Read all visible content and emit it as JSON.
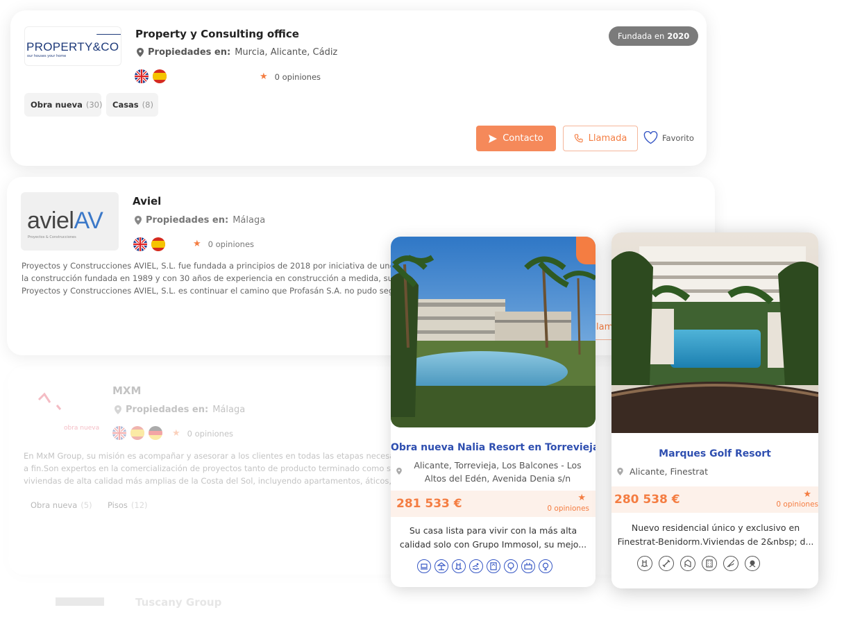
{
  "agencies": [
    {
      "name": "Property y Consulting office",
      "logo_text": "PROPERTY&CO",
      "logo_sub": "our houses your home",
      "locations_label": "Propiedades en:",
      "locations": "Murcia, Alicante, Cádiz",
      "reviews": "0 opiniones",
      "founded_label": "Fundada en",
      "founded_year": "2020",
      "tags": [
        {
          "label": "Obra nueva",
          "count": "(30)"
        },
        {
          "label": "Casas",
          "count": "(8)"
        }
      ],
      "contact_label": "Contacto",
      "call_label": "Llamada",
      "favorite_label": "Favorito"
    },
    {
      "name": "Aviel",
      "logo_text": "aviel",
      "logo_mark": "AV",
      "logo_sub": "Proyectos & Construcciones",
      "locations_label": "Propiedades en:",
      "locations": "Málaga",
      "reviews": "0 opiniones",
      "description": [
        "Proyectos y Construcciones AVIEL, S.L. fue fundada a principios de 2018 por iniciativa de uno de los",
        "la construcción fundada en 1989 y con 30 años de experiencia en construcción a medida, subcontr",
        "Proyectos y Construcciones AVIEL, S.L. es continuar el camino que Profasán S.A. no pudo seguir de"
      ],
      "call_partial": "lam"
    },
    {
      "name": "MXM",
      "logo_text": "obra nueva",
      "locations_label": "Propiedades en:",
      "locations": "Málaga",
      "reviews": "0 opiniones",
      "description": [
        "En MxM Group, su misión es acompañar y asesorar a los clientes en todas las etapas necesarias pa",
        "a fin.Son expertos en la comercialización de proyectos tanto de producto terminado como sobre pl",
        "viviendas de alta calidad más amplias de la Costa del Sol, incluyendo apartamentos, áticos, villas y p"
      ],
      "tags": [
        {
          "label": "Obra nueva",
          "count": "(5)"
        },
        {
          "label": "Pisos",
          "count": "(12)"
        }
      ]
    },
    {
      "name": "Tuscany Group"
    }
  ],
  "properties": [
    {
      "title": "Obra nueva Nalia Resort en Torrevieja",
      "location": "Alicante, Torrevieja, Los Balcones - Los Altos del Edén, Avenida Denia s/n",
      "price": "281 533 €",
      "reviews": "0 opiniones",
      "description": "Su casa lista para vivir con la más alta calidad solo con Grupo Immosol, su mejo...",
      "amenities": [
        "beach-icon",
        "terrace-icon",
        "pool-icon",
        "swim-icon",
        "elevator-icon",
        "garden-icon",
        "spa-icon",
        "golf-icon"
      ]
    },
    {
      "title": "Marques Golf Resort",
      "location": "Alicante, Finestrat",
      "price": "280 538 €",
      "reviews": "0 opiniones",
      "description": "Nuevo residencial único y exclusivo en Finestrat-Benidorm.Viviendas de 2&nbsp; d...",
      "amenities": [
        "pool-icon",
        "gym-icon",
        "playground-icon",
        "building-icon",
        "sauna-icon",
        "golf-course-icon"
      ]
    }
  ],
  "colors": {
    "accent": "#f47d42",
    "link": "#2f4fb0",
    "badge": "#7b7b7b"
  }
}
